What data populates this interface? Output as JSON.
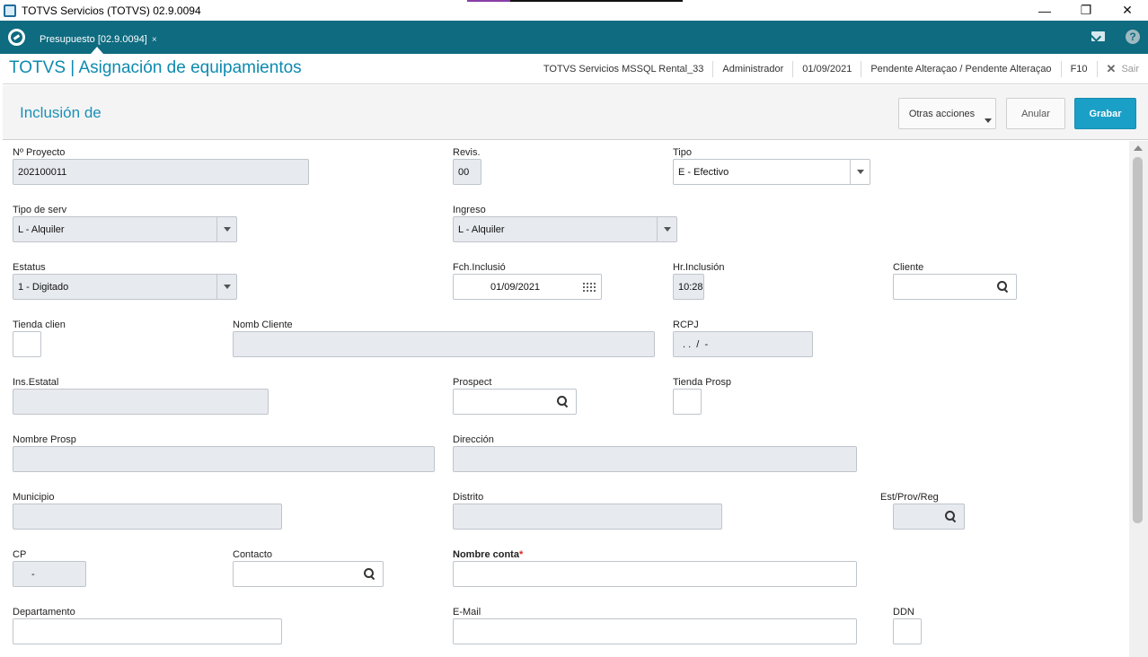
{
  "window": {
    "title": "TOTVS Servicios (TOTVS) 02.9.0094",
    "minimize": "—",
    "maximize": "❐",
    "close": "✕"
  },
  "tabbar": {
    "tab_label": "Presupuesto [02.9.0094]",
    "tab_close": "×",
    "help": "?"
  },
  "header": {
    "title": "TOTVS | Asignación de equipamientos",
    "environment": "TOTVS Servicios MSSQL Rental_33",
    "user": "Administrador",
    "date": "01/09/2021",
    "status": "Pendente Alteraçao / Pendente Alteraçao",
    "shortcut": "F10",
    "exit_icon": "✕",
    "exit_label": "Sair"
  },
  "actionbar": {
    "form_title": "Inclusión de",
    "otras_label": "Otras acciones",
    "anular_label": "Anular",
    "grabar_label": "Grabar"
  },
  "fields": {
    "proyecto": {
      "label": "Nº Proyecto",
      "value": "202100011"
    },
    "revis": {
      "label": "Revis.",
      "value": "00"
    },
    "tipo": {
      "label": "Tipo",
      "value": "E - Efectivo"
    },
    "tipo_serv": {
      "label": "Tipo de serv",
      "value": "L - Alquiler"
    },
    "ingreso": {
      "label": "Ingreso",
      "value": "L - Alquiler"
    },
    "estatus": {
      "label": "Estatus",
      "value": "1 - Digitado"
    },
    "fch_inclusion": {
      "label": "Fch.Inclusió",
      "value": "01/09/2021"
    },
    "hr_inclusion": {
      "label": "Hr.Inclusión",
      "value": "10:28"
    },
    "cliente": {
      "label": "Cliente",
      "value": ""
    },
    "tienda_clien": {
      "label": "Tienda clien",
      "value": ""
    },
    "nomb_cliente": {
      "label": "Nomb Cliente",
      "value": ""
    },
    "rcpj": {
      "label": "RCPJ",
      "value": ". .  /  -"
    },
    "ins_estatal": {
      "label": "Ins.Estatal",
      "value": ""
    },
    "prospect": {
      "label": "Prospect",
      "value": ""
    },
    "tienda_prosp": {
      "label": "Tienda Prosp",
      "value": ""
    },
    "nombre_prosp": {
      "label": "Nombre Prosp",
      "value": ""
    },
    "direccion": {
      "label": "Dirección",
      "value": ""
    },
    "municipio": {
      "label": "Municipio",
      "value": ""
    },
    "distrito": {
      "label": "Distrito",
      "value": ""
    },
    "est_prov_reg": {
      "label": "Est/Prov/Reg",
      "value": ""
    },
    "cp": {
      "label": "CP",
      "value": "-"
    },
    "contacto": {
      "label": "Contacto",
      "value": ""
    },
    "nombre_conta": {
      "label": "Nombre conta",
      "required_mark": "*",
      "value": ""
    },
    "departamento": {
      "label": "Departamento",
      "value": ""
    },
    "email": {
      "label": "E-Mail",
      "value": ""
    },
    "ddn": {
      "label": "DDN",
      "value": ""
    }
  },
  "colors": {
    "tabbar": "#0e6b80",
    "title_blue": "#0d8ab0",
    "primary_button": "#1a9fc7",
    "readonly_field": "#e7eaef",
    "required": "#dd2222"
  }
}
